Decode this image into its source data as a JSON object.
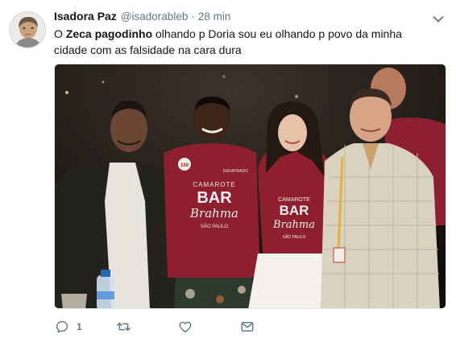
{
  "tweet": {
    "author_name": "Isadora Paz",
    "author_handle": "@isadorableb",
    "separator": "·",
    "time_ago": "28 min",
    "text_before": "O ",
    "text_bold": "Zeca pagodinho",
    "text_after": " olhando p Doria sou eu olhando p povo da minha cidade com as falsidade na cara dura"
  },
  "media": {
    "shirt_small_logo": "100",
    "shirt_line1": "CAMAROTE",
    "shirt_line2": "BAR",
    "shirt_line3": "Brahma",
    "shirt_line4": "SÃO PAULO",
    "sleeve_label": "RAFAPRADO"
  },
  "actions": {
    "reply_count": "1",
    "retweet_count": "",
    "like_count": ""
  },
  "colors": {
    "icon_gray": "#657786",
    "text_dark": "#14171a",
    "shirt_red": "#8e1f2e"
  },
  "icons": [
    "chevron-down-icon",
    "reply-icon",
    "retweet-icon",
    "like-icon",
    "direct-message-icon"
  ]
}
